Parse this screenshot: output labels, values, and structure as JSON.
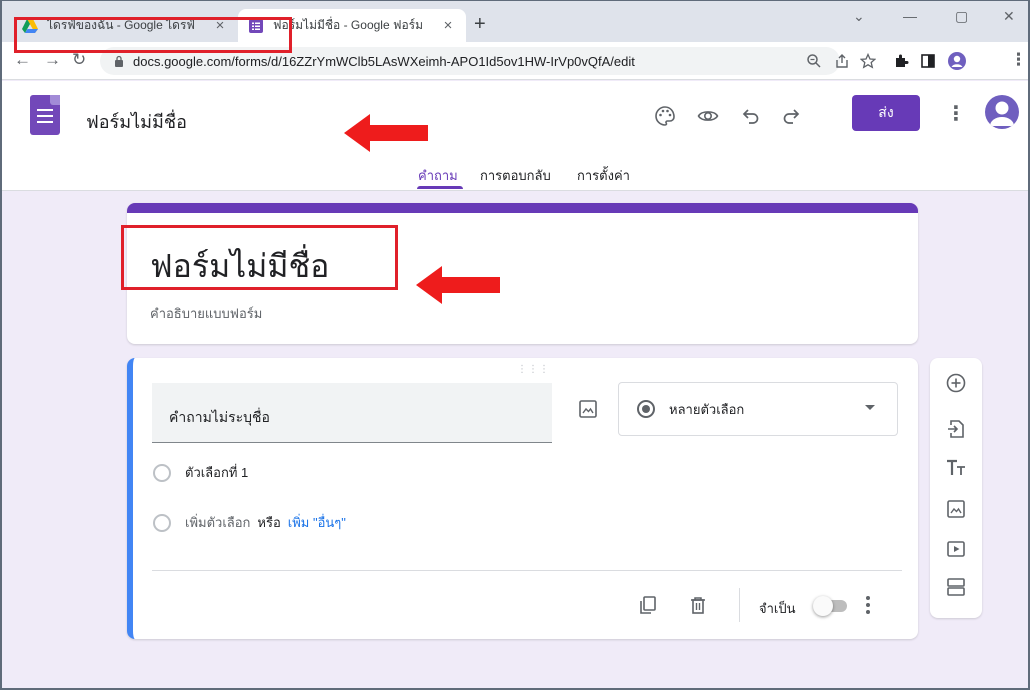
{
  "browser": {
    "tabs": [
      {
        "title": "ไดรฟ์ของฉัน - Google ไดรฟ์",
        "icon": "google-drive-icon"
      },
      {
        "title": "ฟอร์มไม่มีชื่อ - Google ฟอร์ม",
        "icon": "google-forms-icon"
      }
    ],
    "url": "docs.google.com/forms/d/16ZZrYmWClb5LAsWXeimh-APO1Id5ov1HW-IrVp0vQfA/edit"
  },
  "header": {
    "doc_name": "ฟอร์มไม่มีชื่อ",
    "send_label": "ส่ง",
    "tabs": [
      {
        "label": "คำถาม",
        "active": true
      },
      {
        "label": "การตอบกลับ",
        "active": false
      },
      {
        "label": "การตั้งค่า",
        "active": false
      }
    ]
  },
  "title_card": {
    "title": "ฟอร์มไม่มีชื่อ",
    "description_placeholder": "คำอธิบายแบบฟอร์ม"
  },
  "question": {
    "placeholder": "คำถามไม่ระบุชื่อ",
    "type_label": "หลายตัวเลือก",
    "option_1": "ตัวเลือกที่ 1",
    "add_option": "เพิ่มตัวเลือก",
    "or_label": "หรือ",
    "add_other": "เพิ่ม \"อื่นๆ\"",
    "required_label": "จำเป็น"
  },
  "colors": {
    "accent": "#673ab7",
    "highlight": "#e0202a",
    "active_border": "#4285f4"
  }
}
